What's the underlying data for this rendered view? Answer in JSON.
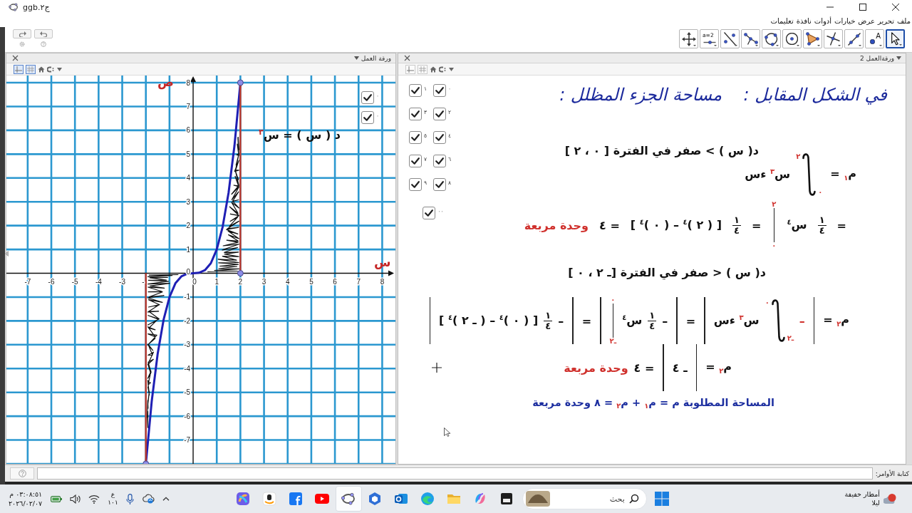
{
  "window": {
    "title": "ج٢.ggb"
  },
  "menu": [
    "ملف",
    "تحرير",
    "عرض",
    "خيارات",
    "أدوات",
    "نافذة",
    "تعليمات"
  ],
  "tools": [
    {
      "kind": "pointer",
      "selected": true
    },
    {
      "kind": "point",
      "label": "A",
      "selected": false
    },
    {
      "kind": "line",
      "selected": false
    },
    {
      "kind": "perpendicular",
      "selected": false
    },
    {
      "kind": "polygon",
      "selected": false
    },
    {
      "kind": "circle",
      "selected": false
    },
    {
      "kind": "conic",
      "selected": false
    },
    {
      "kind": "angle",
      "selected": false
    },
    {
      "kind": "reflect",
      "selected": false
    },
    {
      "kind": "slider",
      "label": "a=2",
      "selected": false
    },
    {
      "kind": "pan",
      "selected": false
    }
  ],
  "graphics_view": {
    "title": "ورقة العمل",
    "style_toggles": [
      {
        "kind": "axes",
        "selected": true
      },
      {
        "kind": "grid",
        "selected": true
      }
    ],
    "checkboxes": [
      {
        "label": "٠",
        "checked": true
      },
      {
        "label": "٠",
        "checked": true
      }
    ],
    "function_label": "د ( س ) = س$^{٣}$",
    "chart_data": {
      "type": "line",
      "xlabel": "س",
      "ylabel": "ص",
      "x": [
        -2,
        -1.75,
        -1.5,
        -1.25,
        -1,
        -0.75,
        -0.5,
        -0.25,
        0,
        0.25,
        0.5,
        0.75,
        1,
        1.25,
        1.5,
        1.75,
        2
      ],
      "series": [
        {
          "color": "#1f1fb4",
          "marker": false,
          "values": [
            -8,
            -5.36,
            -3.38,
            -1.95,
            -1,
            -0.42,
            -0.13,
            -0.02,
            0,
            0.02,
            0.13,
            0.42,
            1,
            1.95,
            3.38,
            5.36,
            8
          ]
        },
        {
          "color": "#8c8ce6",
          "marker": true,
          "values": [
            null,
            null,
            null,
            null,
            null,
            null,
            null,
            null,
            null,
            null,
            null,
            null,
            null,
            null,
            null,
            null,
            0
          ]
        }
      ],
      "xlim": [
        -7.9,
        8.56
      ],
      "ylim": [
        -8,
        8.3
      ],
      "xticks": [
        -7,
        -6,
        -5,
        -4,
        -3,
        {
          "value": -2,
          "label": "-"
        },
        0,
        1,
        2,
        3,
        4,
        5,
        6,
        7,
        8
      ],
      "yticks": [
        -7,
        -6,
        -5,
        -4,
        -3,
        -2,
        -1,
        0,
        1,
        2,
        3,
        4,
        5,
        6,
        7,
        8
      ],
      "grid": true,
      "ref_lines": [
        {
          "axis": "x",
          "value": 2
        },
        {
          "axis": "x",
          "value": -2
        }
      ]
    }
  },
  "graphics_view_2": {
    "title": "ورقةالعمل 2",
    "style_toggles": [
      {
        "kind": "axes",
        "selected": false
      },
      {
        "kind": "grid",
        "selected": false
      }
    ],
    "checkboxes": [
      {
        "label": "٠",
        "checked": true
      },
      {
        "label": "١",
        "checked": true
      },
      {
        "label": "٢",
        "checked": true
      },
      {
        "label": "٣",
        "checked": true
      },
      {
        "label": "٤",
        "checked": true
      },
      {
        "label": "٥",
        "checked": true
      },
      {
        "label": "٦",
        "checked": true
      },
      {
        "label": "٧",
        "checked": true
      },
      {
        "label": "٨",
        "checked": true
      },
      {
        "label": "٩",
        "checked": true
      },
      {
        "label": "٠٠",
        "checked": true
      }
    ],
    "lines": [
      {
        "parts": [
          {
            "kind": "heading",
            "text": "في الشكل المقابل :    مساحة الجزء المظلل :"
          }
        ]
      },
      {
        "parts": [
          {
            "kind": "text",
            "text": "د( س ) > صفر في الفترة [ ٠ ، ٢ ]"
          }
        ]
      },
      {
        "parts": [
          {
            "kind": "text",
            "text": "م$_{١}$ ="
          },
          {
            "kind": "integral",
            "upper": "٢",
            "lower": "٠"
          },
          {
            "kind": "term",
            "text": "س$^{٣}$ ءس"
          }
        ]
      },
      {
        "parts": [
          {
            "kind": "text",
            "text": "="
          },
          {
            "kind": "frac",
            "num": "١",
            "den": "٤"
          },
          {
            "kind": "text",
            "text": "س$^{٤}$"
          },
          {
            "kind": "eval",
            "upper": "٢",
            "lower": "٠"
          },
          {
            "kind": "text",
            "text": "="
          },
          {
            "kind": "frac",
            "num": "١",
            "den": "٤"
          },
          {
            "kind": "text",
            "text": "[ ( ٢ )$^{٤}$ – ( ٠ )$^{٤}$ ]"
          },
          {
            "kind": "text",
            "text": "= ٤"
          },
          {
            "kind": "unit",
            "text": "وحدة مربعة"
          }
        ]
      },
      {
        "parts": [
          {
            "kind": "text",
            "text": "د( س ) < صفر  في الفترة [ـ ٢ ، ٠ ]"
          }
        ]
      },
      {
        "parts": [
          {
            "kind": "text",
            "text": "م$_{٢}$ ="
          },
          {
            "kind": "bar"
          },
          {
            "kind": "sign",
            "text": "–"
          },
          {
            "kind": "integral",
            "upper": "٠",
            "lower": "ـ٢"
          },
          {
            "kind": "term",
            "text": "س$^{٣}$ ءس"
          },
          {
            "kind": "bar"
          },
          {
            "kind": "text",
            "text": "="
          },
          {
            "kind": "bar"
          },
          {
            "kind": "text",
            "text": "–"
          },
          {
            "kind": "frac",
            "num": "١",
            "den": "٤"
          },
          {
            "kind": "text",
            "text": "س$^{٤}$"
          },
          {
            "kind": "eval",
            "upper": "٠",
            "lower": "ـ٢"
          },
          {
            "kind": "bar"
          },
          {
            "kind": "text",
            "text": "="
          },
          {
            "kind": "bar"
          },
          {
            "kind": "text",
            "text": "–"
          },
          {
            "kind": "frac",
            "num": "١",
            "den": "٤"
          },
          {
            "kind": "text",
            "text": "[ ( ٠ )$^{٤}$ – ( ـ ٢ )$^{٤}$ ]"
          },
          {
            "kind": "bar"
          }
        ]
      },
      {
        "parts": [
          {
            "kind": "text",
            "text": "م$_{٢}$ ="
          },
          {
            "kind": "bar"
          },
          {
            "kind": "text",
            "text": "ـ ٤"
          },
          {
            "kind": "bar"
          },
          {
            "kind": "text",
            "text": "= ٤"
          },
          {
            "kind": "unit",
            "text": "وحدة مربعة"
          }
        ]
      },
      {
        "parts": [
          {
            "kind": "result",
            "text": "المساحة المطلوبة م = م$_{١}$ + م$_{٢}$ = ٨ وحدة مربعة"
          }
        ]
      }
    ]
  },
  "input_bar": {
    "label": "كتابة الأوامر:"
  },
  "taskbar": {
    "clock": {
      "time": "٠٣:٠٨:٥١ م",
      "date": "٢٠٢٦/٠٢/٠٧"
    },
    "keyboard": [
      "ع",
      "١٠١"
    ],
    "apps": [
      {
        "kind": "ribbon-tile",
        "selected": false
      },
      {
        "kind": "smile-tile",
        "selected": false
      },
      {
        "kind": "f-tile",
        "selected": false
      },
      {
        "kind": "play",
        "selected": false
      },
      {
        "kind": "ellipse",
        "selected": true
      },
      {
        "kind": "hexagon",
        "selected": false
      },
      {
        "kind": "mail-tile",
        "selected": false
      },
      {
        "kind": "swirl",
        "selected": false
      },
      {
        "kind": "folder",
        "selected": false
      },
      {
        "kind": "ribbon",
        "selected": false
      },
      {
        "kind": "dark-tile",
        "selected": false
      }
    ],
    "search": {
      "placeholder": "بحث"
    },
    "weather": {
      "condition": "أمطار خفيفة",
      "period": "ليلا"
    }
  }
}
